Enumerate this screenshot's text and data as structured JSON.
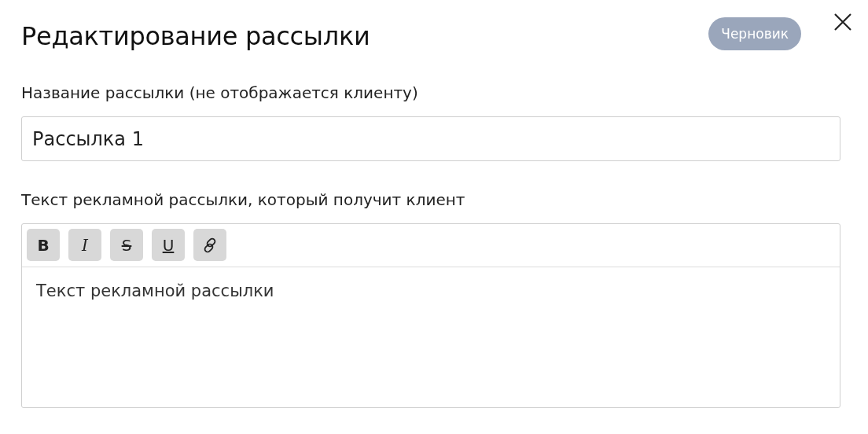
{
  "dialog": {
    "title": "Редактирование рассылки",
    "status_badge": "Черновик"
  },
  "name_field": {
    "label": "Название рассылки (не отображается клиенту)",
    "value": "Рассылка 1"
  },
  "text_field": {
    "label": "Текст рекламной рассылки, который получит клиент",
    "toolbar": [
      {
        "kind": "bold",
        "label": "B"
      },
      {
        "kind": "italic",
        "label": "I"
      },
      {
        "kind": "strike",
        "label": "S"
      },
      {
        "kind": "underline",
        "label": "U"
      },
      {
        "kind": "link"
      }
    ],
    "value": "Текст рекламной рассылки"
  }
}
